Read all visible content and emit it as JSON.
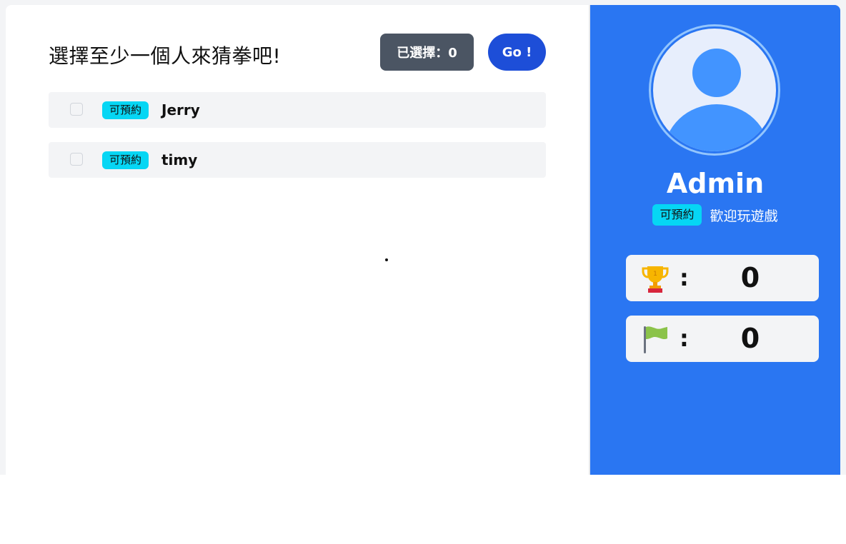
{
  "header": {
    "title": "選擇至少一個人來猜拳吧!",
    "selected_label": "已選擇：0",
    "go_label": "Go !"
  },
  "players": [
    {
      "status": "可預約",
      "name": "Jerry"
    },
    {
      "status": "可預約",
      "name": "timy"
    }
  ],
  "profile": {
    "name": "Admin",
    "status": "可預約",
    "welcome": "歡迎玩遊戲",
    "avatar_icon": "user-avatar-icon"
  },
  "stats": {
    "wins": {
      "icon": "trophy-icon",
      "separator": ":",
      "value": "0"
    },
    "losses": {
      "icon": "flag-icon",
      "separator": ":",
      "value": "0"
    }
  },
  "colors": {
    "sidebar": "#2a76f2",
    "go_button": "#1d4ed8",
    "selected_button": "#4b5563",
    "status_badge": "#06d6f4"
  }
}
